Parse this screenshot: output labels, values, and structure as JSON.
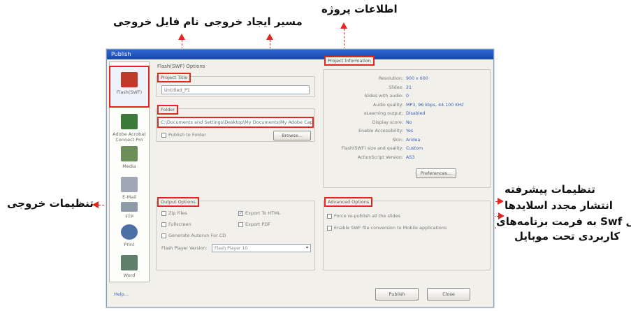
{
  "annotations": {
    "project_info": "اطلاعات پروژه",
    "output_path": "مسیر ایجاد خروجی",
    "output_filename": "نام فایل خروجی",
    "output_settings": "تنظیمات خروجی",
    "advanced_settings": "تنظیمات پیشرفته",
    "republish": "انتشار مجدد اسلایدها",
    "swf_convert_line1": "تبدیل Swf به فرمت برنامه‌های",
    "swf_convert_line2": "کاربردی تحت موبایل"
  },
  "dialog": {
    "title": "Publish",
    "sidebar": [
      {
        "label": "Flash(SWF)",
        "icon": "flash-swf-icon",
        "color": "#c0392b"
      },
      {
        "label": "Adobe Acrobat Connect Pro",
        "icon": "acrobat-connect-icon",
        "color": "#3b7a3b"
      },
      {
        "label": "Media",
        "icon": "media-icon",
        "color": "#6c8f5a"
      },
      {
        "label": "E-Mail",
        "icon": "email-icon",
        "color": "#a0a8b5"
      },
      {
        "label": "FTP",
        "icon": "ftp-icon",
        "color": "#8e9aa8"
      },
      {
        "label": "Print",
        "icon": "print-icon",
        "color": "#4d6fa8"
      },
      {
        "label": "Word",
        "icon": "word-icon",
        "color": "#5f7f6a"
      }
    ],
    "left_panel_title": "Flash(SWF) Options",
    "project_title": {
      "label": "Project Title",
      "value": "Untitled_P1"
    },
    "folder": {
      "label": "Folder",
      "value": "C:\\Documents and Settings\\Desktop\\My Documents\\My Adobe Captivate Projects\\",
      "publish_to_folder": "Publish to Folder",
      "browse": "Browse..."
    },
    "right_panel_title": "Project Information",
    "project_info": [
      {
        "k": "Resolution:",
        "v": "900 x 600"
      },
      {
        "k": "Slides:",
        "v": "21"
      },
      {
        "k": "Slides with audio:",
        "v": "0"
      },
      {
        "k": "Audio quality:",
        "v": "MP3, 96 kbps, 44.100 KHz"
      },
      {
        "k": "eLearning output:",
        "v": "Disabled"
      },
      {
        "k": "Display score:",
        "v": "No"
      },
      {
        "k": "Enable Accessibility:",
        "v": "Yes"
      },
      {
        "k": "Skin:",
        "v": "Aridea"
      },
      {
        "k": "Flash(SWF) size and quality:",
        "v": "Custom"
      },
      {
        "k": "ActionScript Version:",
        "v": "AS3"
      }
    ],
    "preferences_button": "Preferences...",
    "output_options": {
      "title": "Output Options",
      "zip_files": "Zip Files",
      "export_html": "Export To HTML",
      "fullscreen": "Fullscreen",
      "export_pdf": "Export PDF",
      "autorun": "Generate Autorun For CD",
      "flash_player_label": "Flash Player Version:",
      "flash_player_value": "Flash Player 10"
    },
    "advanced_options": {
      "title": "Advanced Options",
      "force_republish": "Force re-publish all the slides",
      "enable_swf": "Enable SWF file conversion to Mobile applications"
    },
    "help_link": "Help...",
    "publish_button": "Publish",
    "close_button": "Close"
  }
}
